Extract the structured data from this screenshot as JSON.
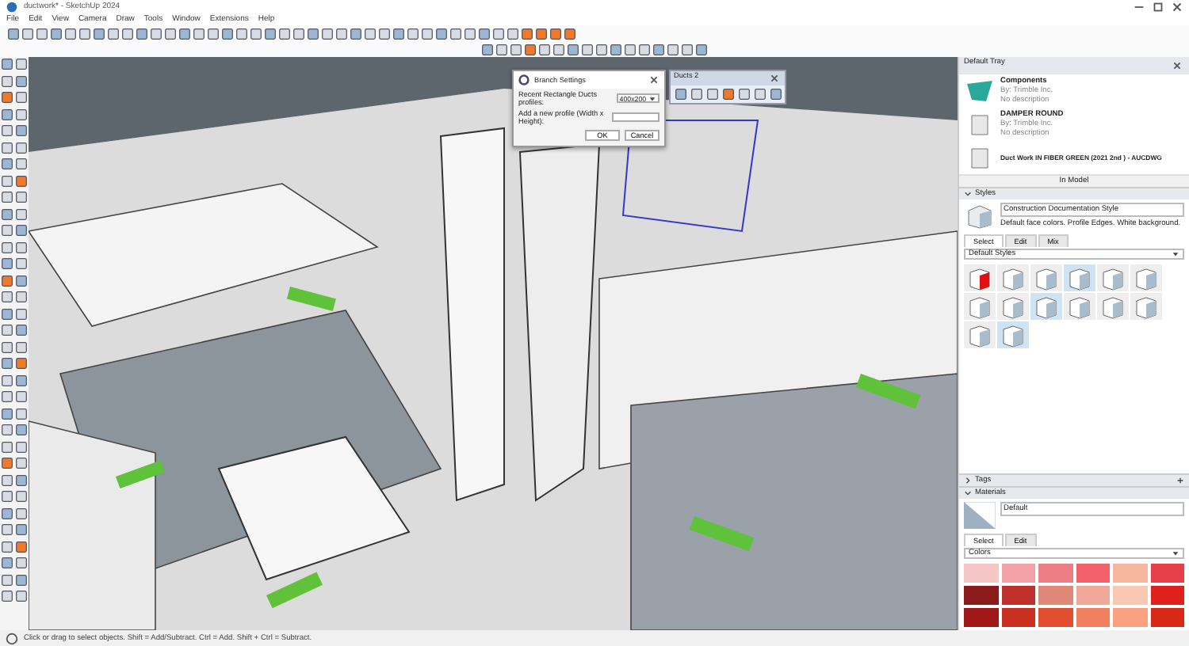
{
  "window": {
    "title": "ductwork* - SketchUp 2024"
  },
  "menu": [
    "File",
    "Edit",
    "View",
    "Camera",
    "Draw",
    "Tools",
    "Window",
    "Extensions",
    "Help"
  ],
  "dialog": {
    "title": "Branch Settings",
    "fields": [
      {
        "label": "Recent Rectangle Ducts profiles:",
        "kind": "dropdown",
        "value": "400x200"
      },
      {
        "label": "Add a new profile (Width x Height):",
        "kind": "text"
      }
    ],
    "buttons": [
      "OK",
      "Cancel"
    ]
  },
  "toolbar_window": {
    "title": "Ducts 2"
  },
  "tray": {
    "title": "Default Tray",
    "components": [
      {
        "name": "Components",
        "author": "By: Trimble Inc.",
        "description": "No description"
      },
      {
        "name": "DAMPER ROUND",
        "author": "By: Trimble Inc.",
        "description": "No description"
      },
      {
        "name": "Duct Work IN FIBER GREEN (2021 2nd ) - AUCDWG"
      }
    ],
    "in_model": "In Model",
    "panels": [
      {
        "kind": "styles",
        "title": "Styles",
        "expanded": true,
        "style_name": "Construction Documentation Style",
        "style_description": "Default face colors. Profile Edges. White background.",
        "tabs": [
          {
            "label": "Select",
            "selected": true
          },
          {
            "label": "Edit",
            "selected": false
          },
          {
            "label": "Mix",
            "selected": false
          }
        ],
        "library": "Default Styles"
      },
      {
        "kind": "tags",
        "title": "Tags",
        "expanded": false
      },
      {
        "kind": "materials",
        "title": "Materials",
        "expanded": true,
        "material_name": "Default",
        "tabs": [
          {
            "label": "Select",
            "selected": true
          },
          {
            "label": "Edit",
            "selected": false
          }
        ],
        "library": "Colors",
        "swatches": [
          {
            "color": "#f5c6c6"
          },
          {
            "color": "#f2a2a4"
          },
          {
            "color": "#ee7e86"
          },
          {
            "color": "#f2606a"
          },
          {
            "color": "#f7b6a0"
          },
          {
            "color": "#e8404a"
          },
          {
            "color": "#8b1a1a"
          },
          {
            "color": "#c0302a"
          },
          {
            "color": "#e08878"
          },
          {
            "color": "#f0a898"
          },
          {
            "color": "#f8c8b0"
          },
          {
            "color": "#e0201a"
          },
          {
            "color": "#a01818"
          },
          {
            "color": "#c83020"
          },
          {
            "color": "#e05030"
          },
          {
            "color": "#f08060"
          },
          {
            "color": "#f8a080"
          },
          {
            "color": "#d82818"
          }
        ]
      }
    ]
  },
  "status_bar": "Click or drag to select objects. Shift = Add/Subtract. Ctrl = Add. Shift + Ctrl = Subtract."
}
